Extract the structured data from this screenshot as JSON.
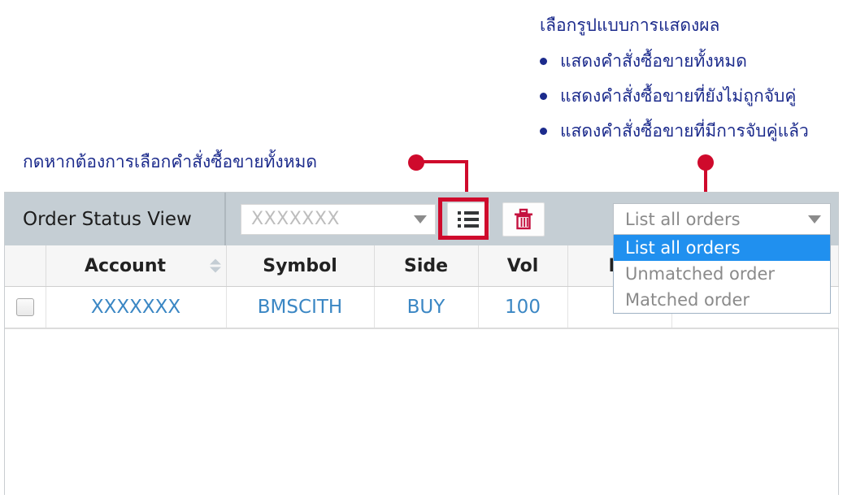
{
  "annotations": {
    "right_title": "เลือกรูปแบบการแสดงผล",
    "right_items": [
      "แสดงคำสั่งซื้อขายทั้งหมด",
      "แสดงคำสั่งซื้อขายที่ยังไม่ถูกจับคู่",
      "แสดงคำสั่งซื้อขายที่มีการจับคู่แล้ว"
    ],
    "left_text": "กดหากต้องการเลือกคำสั่งซื้อขายทั้งหมด",
    "callout_color": "#cf0a2c",
    "text_color": "#1c2b8c"
  },
  "panel": {
    "title": "Order Status View",
    "account_select": {
      "value": "XXXXXXX",
      "caret_icon": "chevron-down-icon"
    },
    "buttons": [
      {
        "name": "list-view-button",
        "icon": "list-icon",
        "highlighted": true
      },
      {
        "name": "delete-button",
        "icon": "trash-icon",
        "color": "#c4123f"
      }
    ],
    "view_select": {
      "value": "List all orders",
      "caret_icon": "chevron-down-icon",
      "expanded": true,
      "selected_index": 0,
      "highlight_color": "#2090ef",
      "options": [
        "List all orders",
        "Unmatched order",
        "Matched order"
      ]
    }
  },
  "table": {
    "columns": [
      {
        "label": "",
        "sortable": false
      },
      {
        "label": "Account",
        "sortable": true
      },
      {
        "label": "Symbol",
        "sortable": false
      },
      {
        "label": "Side",
        "sortable": false
      },
      {
        "label": "Vol",
        "sortable": false
      },
      {
        "label": "Pr",
        "sortable": false
      },
      {
        "label": "",
        "sortable": false
      }
    ],
    "rows": [
      {
        "checkbox": "unchecked",
        "account": "XXXXXXX",
        "symbol": "BMSCITH",
        "side": "BUY",
        "vol": "100",
        "price": "",
        "extra": ""
      }
    ],
    "row_text_color": "#3b87c4"
  }
}
